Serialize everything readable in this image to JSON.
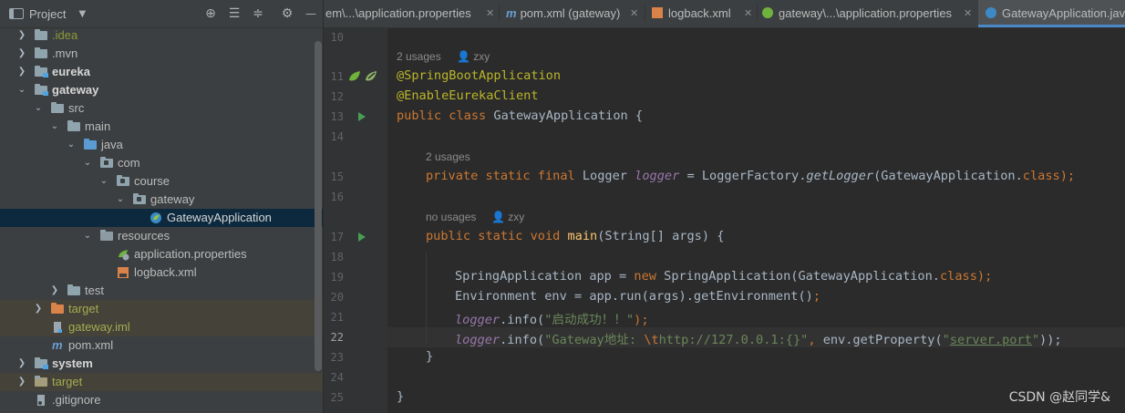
{
  "project_panel": {
    "title": "Project",
    "tree": [
      {
        "label": ".idea",
        "style": "olive"
      },
      {
        "label": ".mvn",
        "style": "normal"
      },
      {
        "label": "eureka",
        "style": "bold"
      },
      {
        "label": "gateway",
        "style": "bold"
      },
      {
        "label": "src",
        "style": "normal"
      },
      {
        "label": "main",
        "style": "normal"
      },
      {
        "label": "java",
        "style": "normal"
      },
      {
        "label": "com",
        "style": "normal"
      },
      {
        "label": "course",
        "style": "normal"
      },
      {
        "label": "gateway",
        "style": "normal"
      },
      {
        "label": "GatewayApplication",
        "style": "normal",
        "selected": true
      },
      {
        "label": "resources",
        "style": "normal"
      },
      {
        "label": "application.properties",
        "style": "normal"
      },
      {
        "label": "logback.xml",
        "style": "normal"
      },
      {
        "label": "test",
        "style": "normal"
      },
      {
        "label": "target",
        "style": "olive"
      },
      {
        "label": "gateway.iml",
        "style": "olive"
      },
      {
        "label": "pom.xml",
        "style": "normal"
      },
      {
        "label": "system",
        "style": "bold"
      },
      {
        "label": "target",
        "style": "olive"
      },
      {
        "label": ".gitignore",
        "style": "normal"
      }
    ]
  },
  "tabs": [
    {
      "label": "em\\...\\application.properties",
      "active": false
    },
    {
      "label": "pom.xml (gateway)",
      "active": false
    },
    {
      "label": "logback.xml",
      "active": false
    },
    {
      "label": "gateway\\...\\application.properties",
      "active": false
    },
    {
      "label": "GatewayApplication.jav",
      "active": true
    }
  ],
  "editor": {
    "line_numbers": [
      "10",
      "11",
      "12",
      "13",
      "14",
      "15",
      "16",
      "17",
      "18",
      "19",
      "20",
      "21",
      "22",
      "23",
      "24",
      "25"
    ],
    "current_line": "22",
    "hints": {
      "class_usages": "2 usages",
      "class_author": "zxy",
      "logger_usages": "2 usages",
      "main_usages": "no usages",
      "main_author": "zxy"
    },
    "code": {
      "l11": "@SpringBootApplication",
      "l12": "@EnableEurekaClient",
      "l13_kw": "public class ",
      "l13_name": "GatewayApplication {",
      "l15_kw": "private static final ",
      "l15_type": "Logger ",
      "l15_field": "logger",
      "l15_eq": " = LoggerFactory.",
      "l15_method": "getLogger",
      "l15_arg": "(GatewayApplication.",
      "l15_class": "class",
      "l15_end": ");",
      "l17_kw": "public static void ",
      "l17_method": "main",
      "l17_rest": "(String[] args) {",
      "l19_a": "SpringApplication app = ",
      "l19_new": "new ",
      "l19_b": "SpringApplication(GatewayApplication.",
      "l19_class": "class",
      "l19_end": ");",
      "l20_a": "Environment env = app.run(args).getEnvironment()",
      "l20_end": ";",
      "l21_field": "logger",
      "l21_a": ".info(",
      "l21_str": "\"启动成功！！\"",
      "l21_end": ");",
      "l22_field": "logger",
      "l22_a": ".info(",
      "l22_str1": "\"Gateway地址: ",
      "l22_esc": "\\t",
      "l22_str2": "http://127.0.0.1:{}\"",
      "l22_comma": ", ",
      "l22_b": "env.getProperty(",
      "l22_q1": "\"",
      "l22_link": "server.port",
      "l22_q2": "\"",
      "l22_end": "));",
      "l23": "}",
      "l25": "}"
    }
  },
  "watermark": "CSDN @赵同学&"
}
